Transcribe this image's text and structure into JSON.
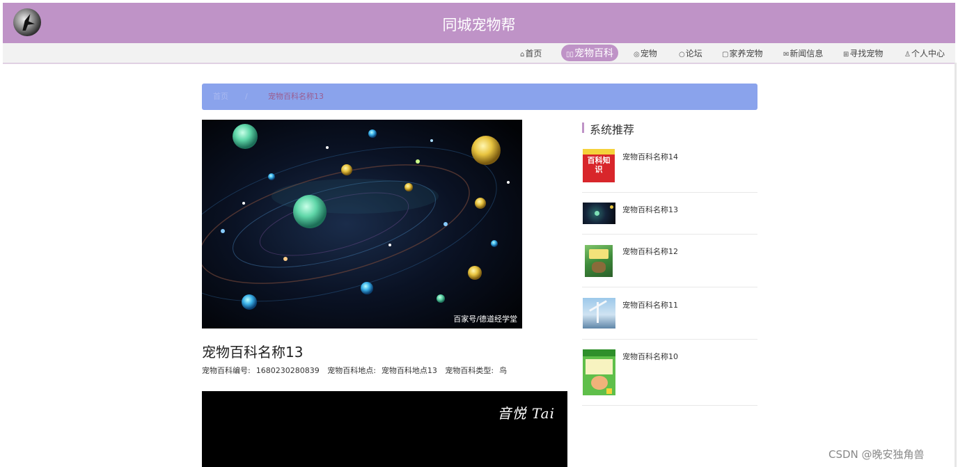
{
  "header": {
    "site_title": "同城宠物帮"
  },
  "nav": {
    "items": [
      {
        "icon": "home-icon",
        "glyph": "⌂",
        "label": "首页"
      },
      {
        "icon": "book-icon",
        "glyph": "▯▯",
        "label": "宠物百科",
        "active": true
      },
      {
        "icon": "pet-icon",
        "glyph": "◎",
        "label": "宠物"
      },
      {
        "icon": "chat-icon",
        "glyph": "○",
        "label": "论坛"
      },
      {
        "icon": "doc-icon",
        "glyph": "▢",
        "label": "家养宠物"
      },
      {
        "icon": "mail-icon",
        "glyph": "✉",
        "label": "新闻信息"
      },
      {
        "icon": "search-pet-icon",
        "glyph": "⊞",
        "label": "寻找宠物"
      },
      {
        "icon": "user-icon",
        "glyph": "♙",
        "label": "个人中心"
      }
    ]
  },
  "breadcrumb": {
    "home": "首页",
    "separator": "/",
    "current": "宠物百科名称13"
  },
  "article": {
    "image_caption": "百家号/德道经学堂",
    "title": "宠物百科名称13",
    "meta": {
      "number_label": "宠物百科编号:",
      "number_value": "1680230280839",
      "place_label": "宠物百科地点:",
      "place_value": "宠物百科地点13",
      "type_label": "宠物百科类型:",
      "type_value": "鸟"
    },
    "video_logo": "音悦 Tai"
  },
  "recommend": {
    "title": "系统推荐",
    "items": [
      {
        "name": "宠物百科名称14",
        "thumb_text": "百科知识"
      },
      {
        "name": "宠物百科名称13"
      },
      {
        "name": "宠物百科名称12"
      },
      {
        "name": "宠物百科名称11"
      },
      {
        "name": "宠物百科名称10"
      }
    ]
  },
  "watermark": "CSDN @晚安独角兽",
  "colors": {
    "brand": "#bf93c7",
    "breadcrumb_bg": "#8aa3ec",
    "breadcrumb_current": "#9b5c8f"
  }
}
